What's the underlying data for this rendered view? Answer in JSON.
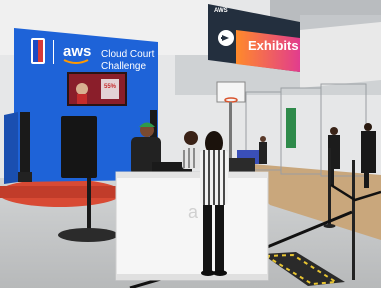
{
  "booth": {
    "brand_wordmark": "aws",
    "title_line1": "Cloud Court",
    "title_line2": "Challenge",
    "screen_text": "55%"
  },
  "signage": {
    "exhibits_label": "Exhibits",
    "aws_tag": "AWS"
  },
  "colors": {
    "booth_blue": "#1e63d8",
    "exhibits_gradient_start": "#ff8a2a",
    "exhibits_gradient_end": "#e23c8e",
    "stage_red": "#d84a34",
    "carpet": "#c9a77c"
  }
}
